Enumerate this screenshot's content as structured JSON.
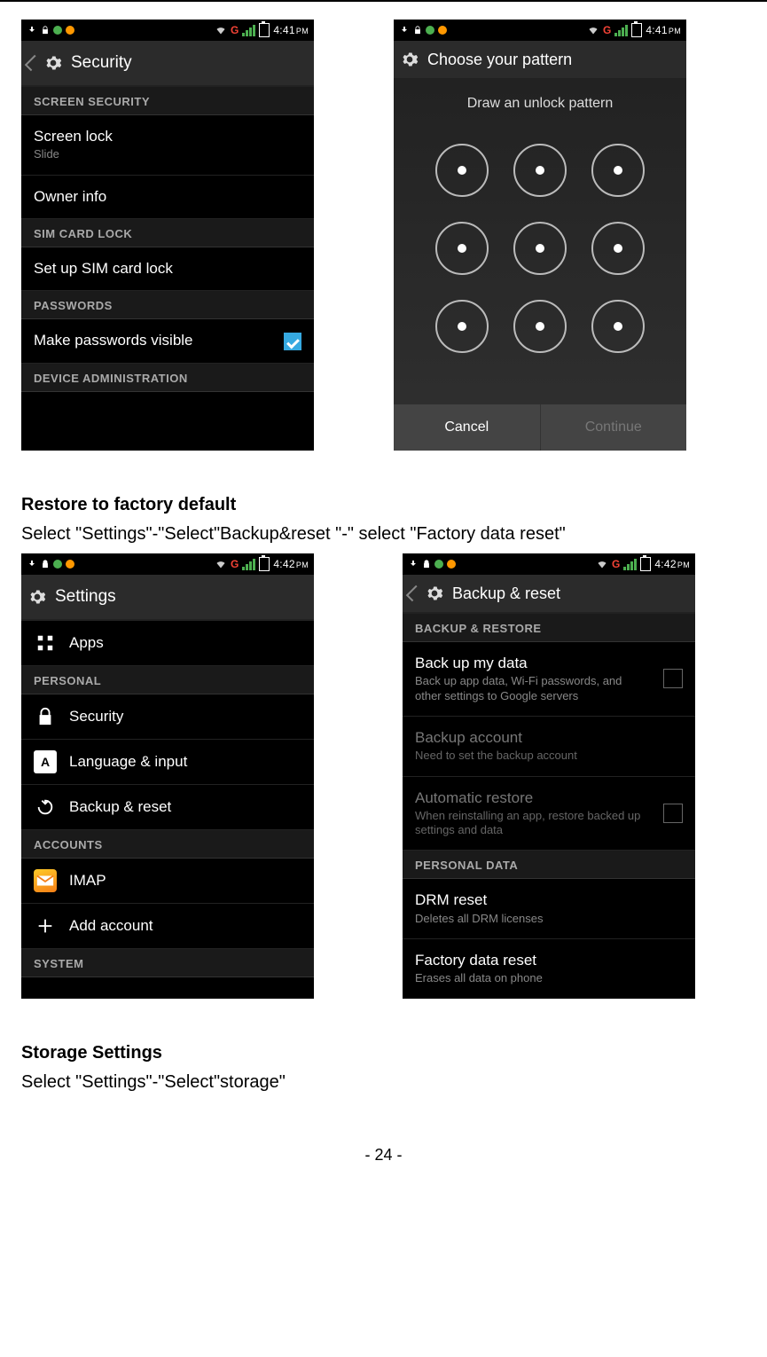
{
  "status": {
    "time": "4:41",
    "pm": "PM",
    "g_label": "G"
  },
  "status2": {
    "time": "4:42",
    "pm": "PM",
    "g_label": "G"
  },
  "shot_security": {
    "title": "Security",
    "sections": {
      "screen_security": "SCREEN SECURITY",
      "sim_card_lock": "SIM CARD LOCK",
      "passwords": "PASSWORDS",
      "device_admin": "DEVICE ADMINISTRATION"
    },
    "items": {
      "screen_lock": {
        "title": "Screen lock",
        "subtitle": "Slide"
      },
      "owner_info": "Owner info",
      "setup_sim": "Set up SIM card lock",
      "make_pw_visible": "Make passwords visible"
    }
  },
  "shot_pattern": {
    "title": "Choose your pattern",
    "caption": "Draw an unlock pattern",
    "cancel": "Cancel",
    "continue": "Continue"
  },
  "doc": {
    "heading1": "Restore to factory default",
    "text1": "Select \"Settings\"-\"Select\"Backup&reset \"-\" select \"Factory data reset\"",
    "heading2": "Storage Settings",
    "text2": "Select \"Settings\"-\"Select\"storage\"",
    "page_num": "- 24 -"
  },
  "shot_settings": {
    "title": "Settings",
    "sections": {
      "personal": "PERSONAL",
      "accounts": "ACCOUNTS",
      "system": "SYSTEM"
    },
    "items": {
      "apps": "Apps",
      "security": "Security",
      "language": "Language & input",
      "backup": "Backup & reset",
      "imap": "IMAP",
      "add_account": "Add account"
    }
  },
  "shot_backup": {
    "title": "Backup & reset",
    "sections": {
      "backup_restore": "BACKUP & RESTORE",
      "personal_data": "PERSONAL DATA"
    },
    "items": {
      "back_up_my_data": {
        "title": "Back up my data",
        "subtitle": "Back up app data, Wi-Fi passwords, and other settings to Google servers"
      },
      "backup_account": {
        "title": "Backup account",
        "subtitle": "Need to set the backup account"
      },
      "automatic_restore": {
        "title": "Automatic restore",
        "subtitle": "When reinstalling an app, restore backed up settings and data"
      },
      "drm_reset": {
        "title": "DRM reset",
        "subtitle": "Deletes all DRM licenses"
      },
      "factory_reset": {
        "title": "Factory data reset",
        "subtitle": "Erases all data on phone"
      }
    }
  }
}
